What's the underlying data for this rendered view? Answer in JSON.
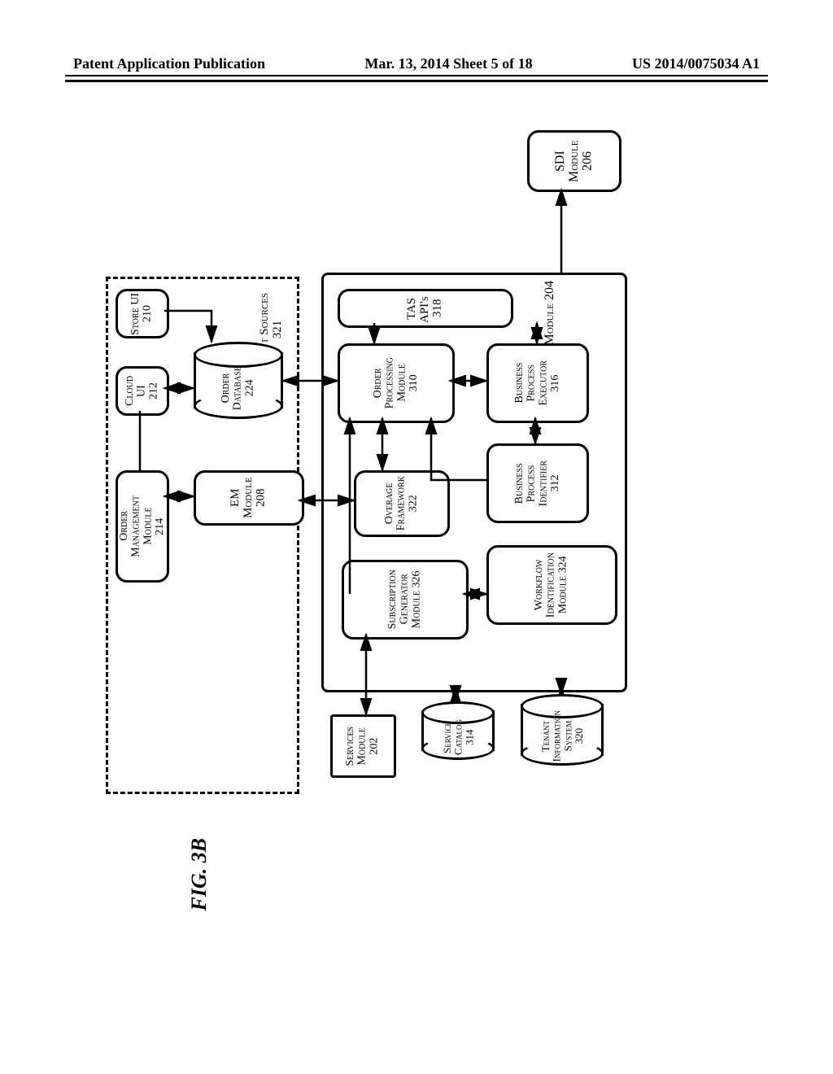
{
  "header": {
    "left": "Patent Application Publication",
    "center": "Mar. 13, 2014  Sheet 5 of 18",
    "right": "US 2014/0075034 A1"
  },
  "figure_caption": "FIG. 3B",
  "input_sources": {
    "label": "Input Sources",
    "num": "321"
  },
  "tas_module": {
    "label": "TAS Module",
    "num": "204"
  },
  "store_ui": {
    "label": "Store UI",
    "num": "210"
  },
  "cloud_ui": {
    "label": "Cloud UI",
    "num": "212"
  },
  "order_management_module": {
    "label1": "Order",
    "label2": "Management",
    "label3": "Module",
    "num": "214"
  },
  "order_database": {
    "label1": "Order",
    "label2": "Database",
    "num": "224"
  },
  "em_module": {
    "label": "EM Module",
    "num": "208"
  },
  "tas_apis": {
    "label": "TAS API's",
    "num": "318"
  },
  "order_processing_module": {
    "label1": "Order",
    "label2": "Processing",
    "label3": "Module",
    "num": "310"
  },
  "overage_framework": {
    "label1": "Overage",
    "label2": "Framework",
    "num": "322"
  },
  "subscription_generator": {
    "label1": "Subscription",
    "label2": "Generator",
    "label3": "Module",
    "num": "326"
  },
  "business_process_executor": {
    "label1": "Business",
    "label2": "Process",
    "label3": "Executor",
    "num": "316"
  },
  "business_process_identifier": {
    "label1": "Business",
    "label2": "Process",
    "label3": "Identifier",
    "num": "312"
  },
  "workflow_identification": {
    "label1": "Workflow",
    "label2": "Identification",
    "label3": "Module",
    "num": "324"
  },
  "sdi_module": {
    "label": "SDI Module",
    "num": "206"
  },
  "services_module": {
    "label1": "Services",
    "label2": "Module",
    "num": "202"
  },
  "service_catalog": {
    "label1": "Service",
    "label2": "Catalog",
    "num": "314"
  },
  "tenant_info_system": {
    "label1": "Tenant",
    "label2": "Information",
    "label3": "System",
    "num": "320"
  }
}
